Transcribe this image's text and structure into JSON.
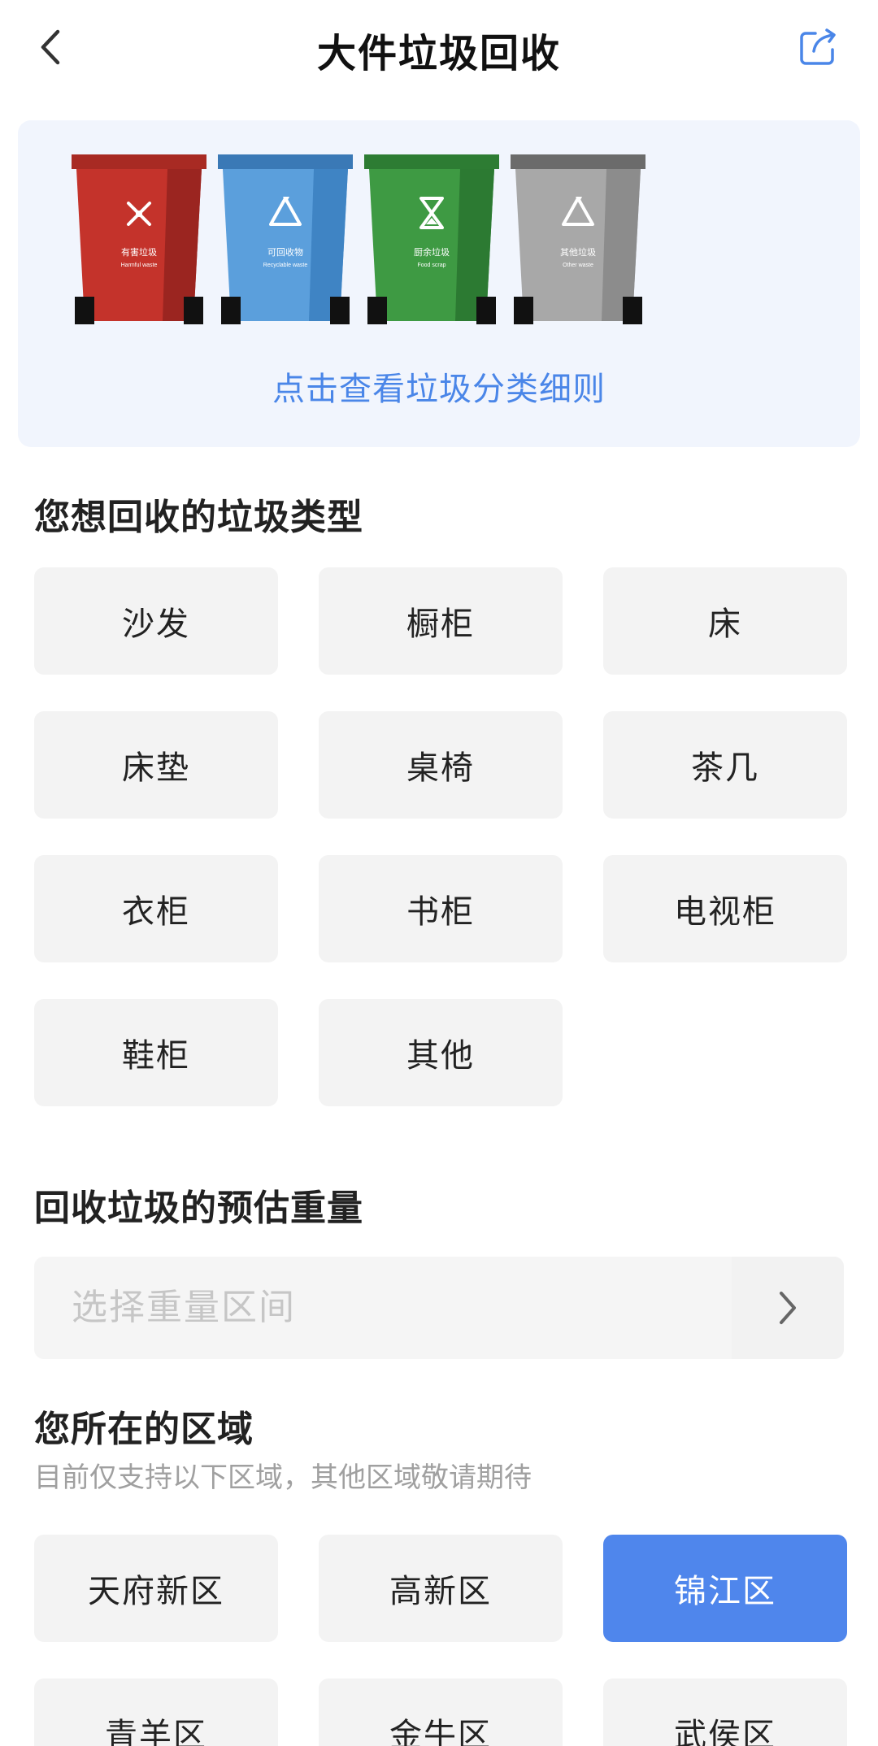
{
  "nav": {
    "title": "大件垃圾回收",
    "back_icon": "chevron-left-icon",
    "share_icon": "share-icon"
  },
  "banner": {
    "bins": [
      {
        "name": "有害垃圾",
        "en": "Harmful waste",
        "color": "#c4332b",
        "dark": "#9b2520",
        "lid": "#a82a23",
        "symbol": "harmful-icon"
      },
      {
        "name": "可回收物",
        "en": "Recyclable waste",
        "color": "#5b9fdc",
        "dark": "#3f84c4",
        "lid": "#3a79b6",
        "symbol": "recycle-icon"
      },
      {
        "name": "厨余垃圾",
        "en": "Food scrap",
        "color": "#3e9a43",
        "dark": "#2c7a32",
        "lid": "#2d7c33",
        "symbol": "hourglass-icon"
      },
      {
        "name": "其他垃圾",
        "en": "Other waste",
        "color": "#a8a8a8",
        "dark": "#8c8c8c",
        "lid": "#6b6b6b",
        "symbol": "recycle-icon"
      }
    ],
    "link_text": "点击查看垃圾分类细则",
    "link_color": "#4a86e8"
  },
  "waste_types": {
    "title": "您想回收的垃圾类型",
    "items": [
      "沙发",
      "橱柜",
      "床",
      "床垫",
      "桌椅",
      "茶几",
      "衣柜",
      "书柜",
      "电视柜",
      "鞋柜",
      "其他"
    ]
  },
  "weight": {
    "title": "回收垃圾的预估重量",
    "placeholder": "选择重量区间"
  },
  "region": {
    "title": "您所在的区域",
    "subtitle": "目前仅支持以下区域，其他区域敬请期待",
    "items": [
      "天府新区",
      "高新区",
      "锦江区",
      "青羊区",
      "金牛区",
      "武侯区"
    ],
    "selected": "锦江区",
    "selected_color": "#4f86ec"
  }
}
